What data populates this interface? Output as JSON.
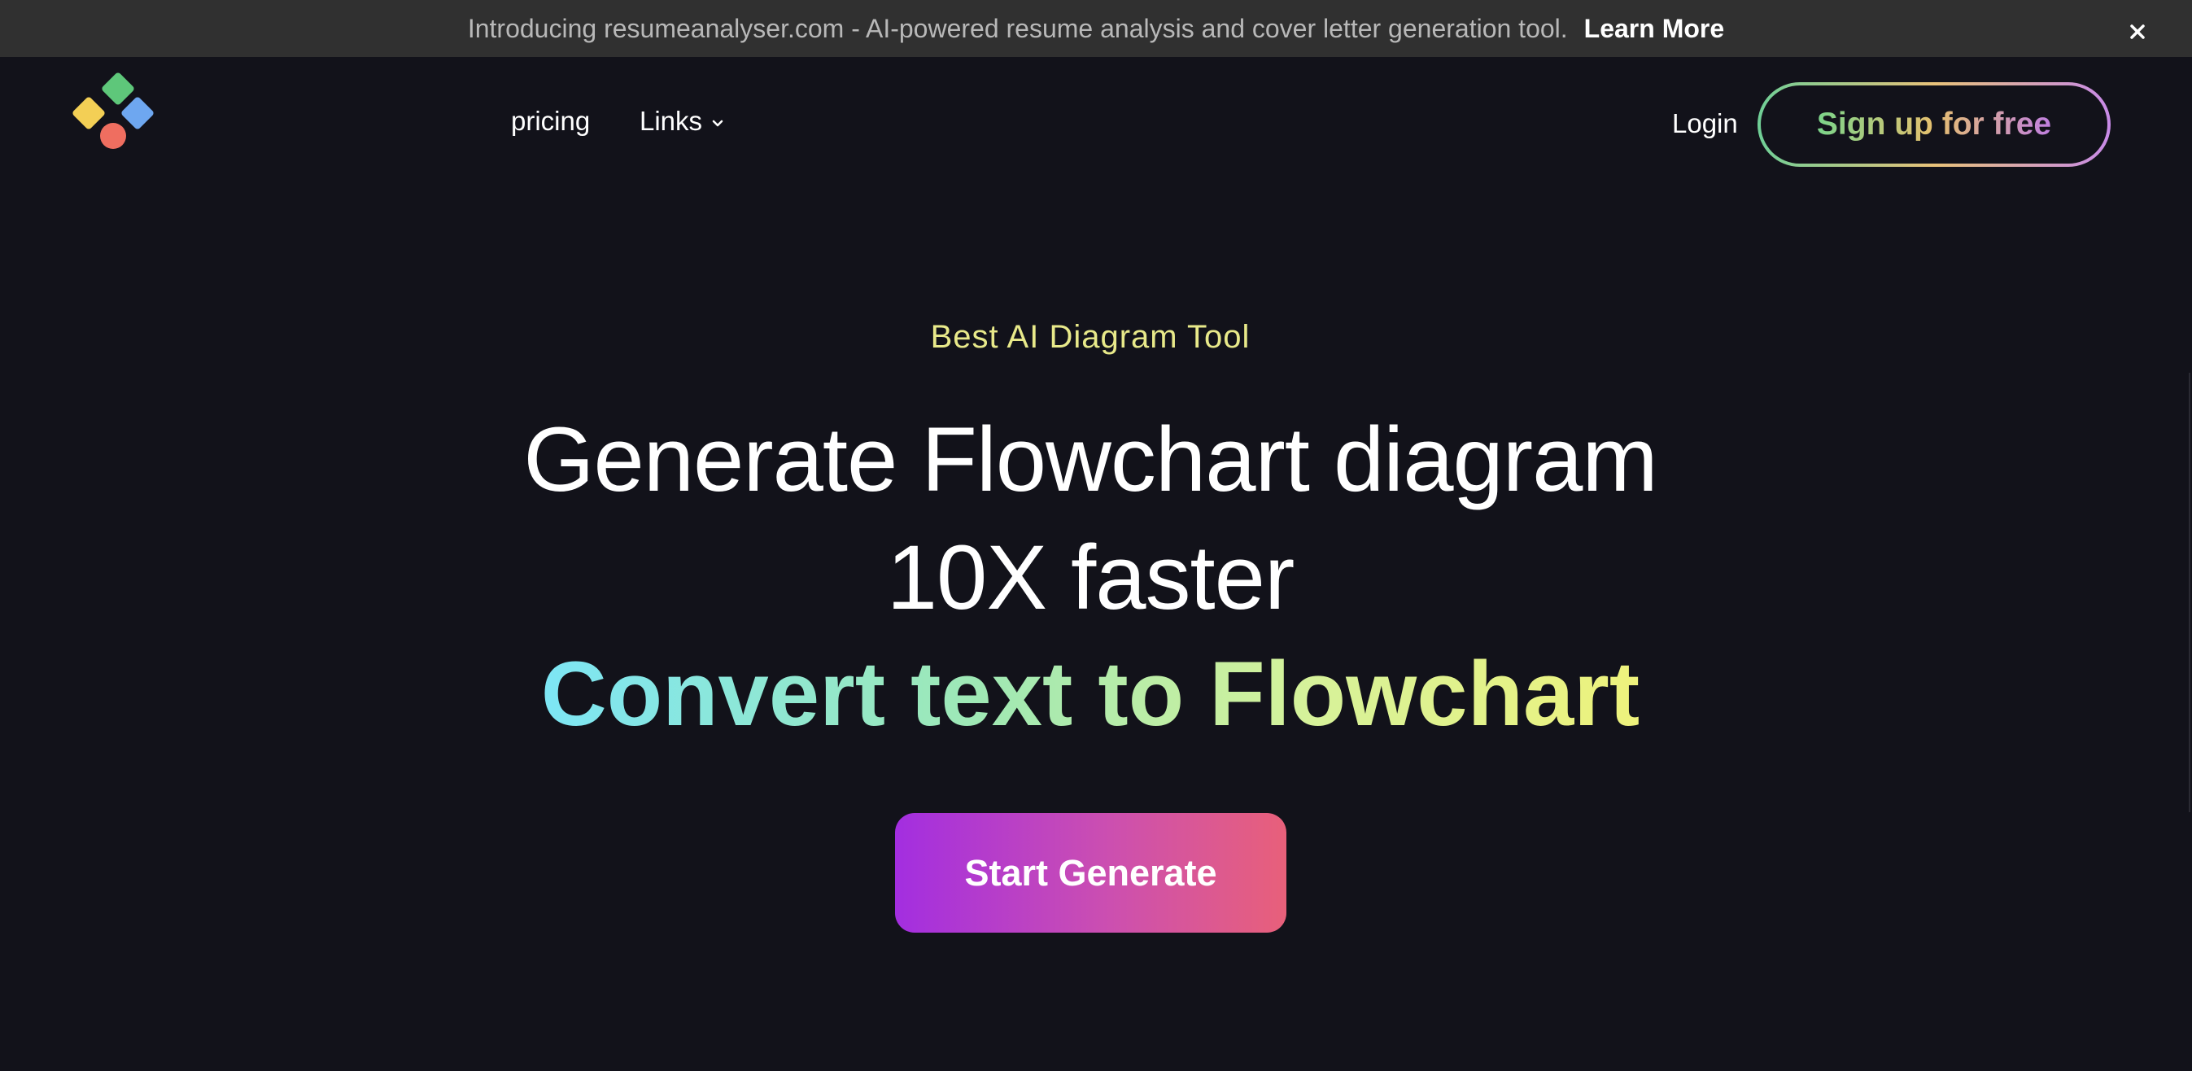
{
  "announcement": {
    "text": "Introducing resumeanalyser.com - AI-powered resume analysis and cover letter generation tool.",
    "link_label": "Learn More",
    "close_icon": "close-icon"
  },
  "nav": {
    "logo_icon": "diamond-shapes-logo-icon",
    "links": [
      {
        "label": "pricing"
      },
      {
        "label": "Links",
        "icon": "chevron-down-icon"
      }
    ],
    "login_label": "Login",
    "signup_label": "Sign up for free"
  },
  "hero": {
    "tagline": "Best AI Diagram Tool",
    "headline_line1": "Generate Flowchart diagram",
    "headline_line2": "10X faster",
    "headline_gradient": "Convert text to Flowchart",
    "cta_label": "Start Generate"
  },
  "colors": {
    "background": "#12121a",
    "announce_bar": "#303030",
    "tagline": "#e8e98a",
    "cta_start": "#a32ee0",
    "cta_end": "#e8607a"
  }
}
